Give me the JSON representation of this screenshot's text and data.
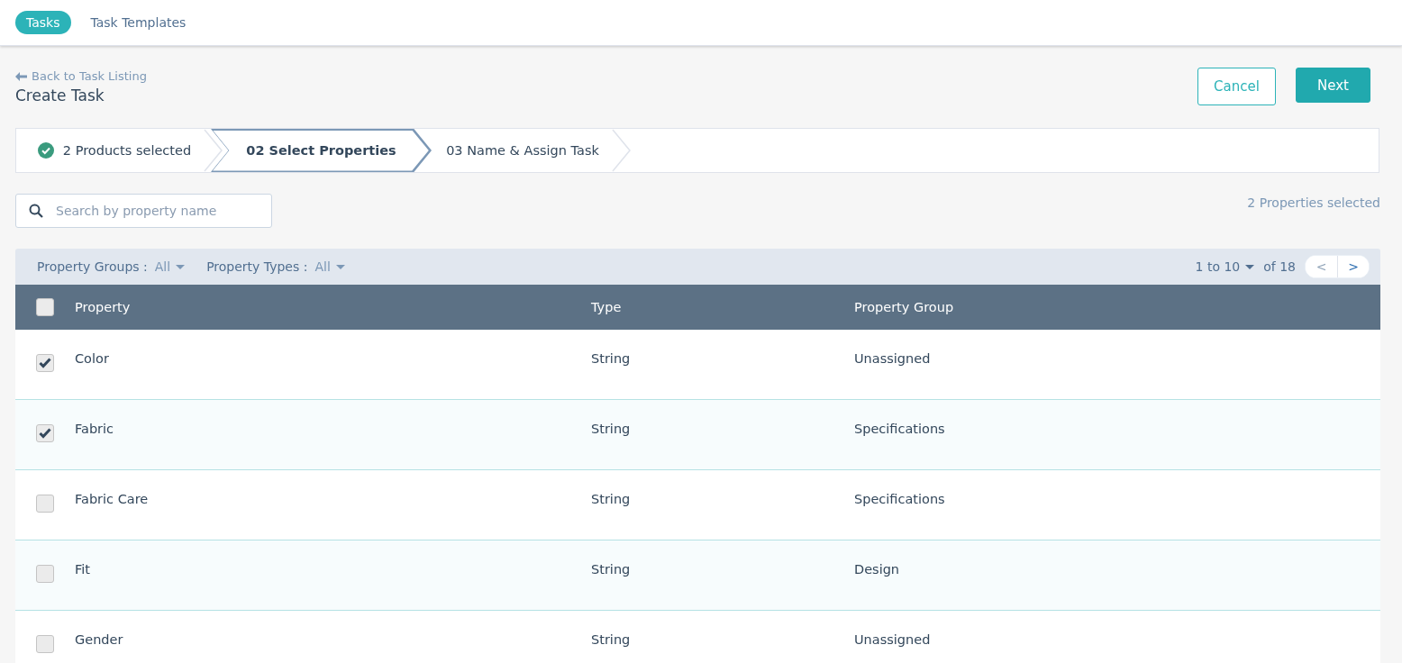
{
  "nav_tabs": [
    {
      "label": "Tasks",
      "selected": true
    },
    {
      "label": "Task Templates",
      "selected": false
    }
  ],
  "back_link": "Back to Task Listing",
  "page_title": "Create Task",
  "buttons": {
    "cancel": "Cancel",
    "next": "Next"
  },
  "steps": [
    {
      "label": "2 Products selected",
      "completed": true,
      "selected": false
    },
    {
      "label": "02 Select Properties",
      "completed": false,
      "selected": true
    },
    {
      "label": "03 Name & Assign Task",
      "completed": false,
      "selected": false
    }
  ],
  "search": {
    "placeholder": "Search by property name"
  },
  "selection_count": "2 Properties selected",
  "filters": [
    {
      "label": "Property Groups :",
      "value": "All"
    },
    {
      "label": "Property Types :",
      "value": "All"
    }
  ],
  "pager": {
    "range": "1 to 10",
    "total": "of 18",
    "prev": "<",
    "next": ">",
    "prev_disabled": true
  },
  "table": {
    "select_all_checked": false,
    "columns": [
      "Property",
      "Type",
      "Property Group"
    ],
    "rows": [
      {
        "cells": [
          "Color",
          "String",
          "Unassigned"
        ],
        "checked": true
      },
      {
        "cells": [
          "Fabric",
          "String",
          "Specifications"
        ],
        "checked": true
      },
      {
        "cells": [
          "Fabric Care",
          "String",
          "Specifications"
        ],
        "checked": false
      },
      {
        "cells": [
          "Fit",
          "String",
          "Design"
        ],
        "checked": false
      },
      {
        "cells": [
          "Gender",
          "String",
          "Unassigned"
        ],
        "checked": false
      }
    ]
  }
}
